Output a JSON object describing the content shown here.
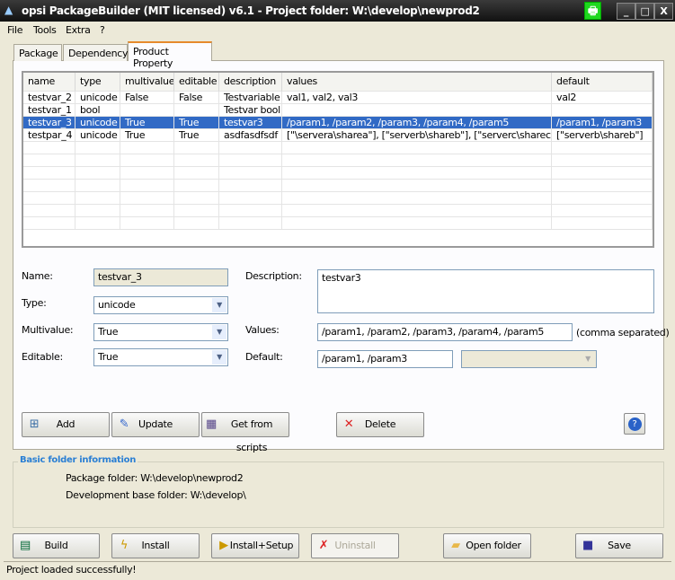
{
  "window": {
    "title": "opsi PackageBuilder (MIT licensed) v6.1 - Project folder: W:\\develop\\newprod2",
    "minimize": "_",
    "maximize": "□",
    "close": "X"
  },
  "menu": [
    "File",
    "Tools",
    "Extra",
    "?"
  ],
  "tabs": [
    {
      "label": "Package"
    },
    {
      "label": "Dependency"
    },
    {
      "label": "Product Property",
      "active": true
    }
  ],
  "grid": {
    "columns": [
      "name",
      "type",
      "multivalue",
      "editable",
      "description",
      "values",
      "default"
    ],
    "rows": [
      [
        "testvar_2",
        "unicode",
        "False",
        "False",
        "Testvariable",
        "val1, val2, val3",
        "val2"
      ],
      [
        "testvar_1",
        "bool",
        "",
        "",
        "Testvar bool",
        "",
        ""
      ],
      [
        "testvar_3",
        "unicode",
        "True",
        "True",
        "testvar3",
        "/param1, /param2, /param3, /param4, /param5",
        "/param1, /param3"
      ],
      [
        "testpar_4",
        "unicode",
        "True",
        "True",
        "asdfasdfsdf",
        "[\"\\servera\\sharea\"], [\"serverb\\shareb\"], [\"serverc\\sharec\"]",
        "[\"serverb\\shareb\"]"
      ]
    ],
    "selected_row": 2
  },
  "form": {
    "name_label": "Name:",
    "name_value": "testvar_3",
    "type_label": "Type:",
    "type_value": "unicode",
    "multivalue_label": "Multivalue:",
    "multivalue_value": "True",
    "editable_label": "Editable:",
    "editable_value": "True",
    "description_label": "Description:",
    "description_value": "testvar3",
    "values_label": "Values:",
    "values_value": "/param1, /param2, /param3, /param4, /param5",
    "values_hint": "(comma separated)",
    "default_label": "Default:",
    "default_value": "/param1, /param3"
  },
  "actions": {
    "add": "Add",
    "update": "Update",
    "get_from_scripts": "Get from scripts",
    "delete": "Delete"
  },
  "folder_info": {
    "title": "Basic folder information",
    "package_folder": "Package folder: W:\\develop\\newprod2",
    "base_folder": "Development base folder: W:\\develop\\"
  },
  "bottom": {
    "build": "Build",
    "install": "Install",
    "install_setup": "Install+Setup",
    "uninstall": "Uninstall",
    "open_folder": "Open folder",
    "save": "Save"
  },
  "status": "Project loaded successfully!",
  "colors": {
    "selection": "#316ac5",
    "group_title": "#2a7fd4"
  }
}
